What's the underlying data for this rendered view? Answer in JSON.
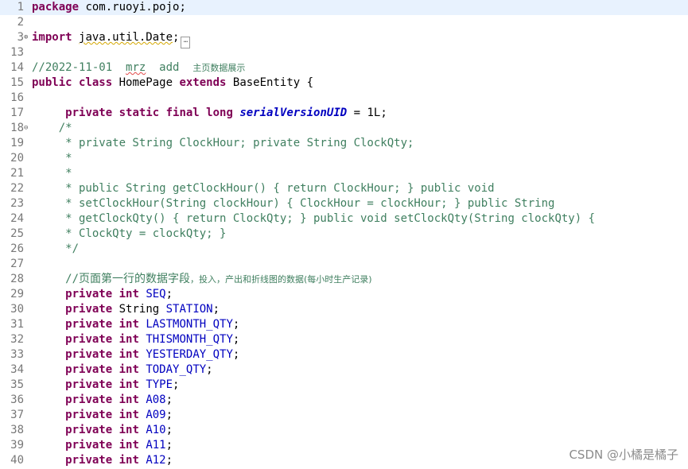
{
  "editor": {
    "lines": [
      {
        "n": "1",
        "segs": [
          {
            "t": "package",
            "c": "kw"
          },
          {
            "t": " com.ruoyi.pojo;"
          }
        ]
      },
      {
        "n": "2",
        "segs": []
      },
      {
        "n": "3",
        "fold": "⊕",
        "segs": [
          {
            "t": "import",
            "c": "kw"
          },
          {
            "t": " "
          },
          {
            "t": "java.util.Date",
            "c": "warn"
          },
          {
            "t": ";"
          },
          {
            "t": "…",
            "c": "collapsed"
          }
        ]
      },
      {
        "n": "13",
        "segs": []
      },
      {
        "n": "14",
        "segs": [
          {
            "t": "//2022-11-01  ",
            "c": "cm"
          },
          {
            "t": "mrz",
            "c": "cm spell"
          },
          {
            "t": "  add  ",
            "c": "cm"
          },
          {
            "t": "主页数据展示",
            "c": "cm cjk"
          }
        ]
      },
      {
        "n": "15",
        "segs": [
          {
            "t": "public class",
            "c": "kw"
          },
          {
            "t": " HomePage "
          },
          {
            "t": "extends",
            "c": "kw"
          },
          {
            "t": " BaseEntity {"
          }
        ]
      },
      {
        "n": "16",
        "segs": []
      },
      {
        "n": "17",
        "segs": [
          {
            "t": "     "
          },
          {
            "t": "private static final long",
            "c": "kw"
          },
          {
            "t": " "
          },
          {
            "t": "serialVersionUID",
            "c": "sf"
          },
          {
            "t": " = 1L;"
          }
        ]
      },
      {
        "n": "18",
        "fold": "⊖",
        "segs": [
          {
            "t": "    /*",
            "c": "cm"
          }
        ]
      },
      {
        "n": "19",
        "segs": [
          {
            "t": "     * private String ClockHour; private String ClockQty;",
            "c": "cm"
          }
        ]
      },
      {
        "n": "20",
        "segs": [
          {
            "t": "     *",
            "c": "cm"
          }
        ]
      },
      {
        "n": "21",
        "segs": [
          {
            "t": "     *",
            "c": "cm"
          }
        ]
      },
      {
        "n": "22",
        "segs": [
          {
            "t": "     * public String getClockHour() { return ClockHour; } public void",
            "c": "cm"
          }
        ]
      },
      {
        "n": "23",
        "segs": [
          {
            "t": "     * setClockHour(String clockHour) { ClockHour = clockHour; } public String",
            "c": "cm"
          }
        ]
      },
      {
        "n": "24",
        "segs": [
          {
            "t": "     * getClockQty() { return ClockQty; } public void setClockQty(String clockQty) {",
            "c": "cm"
          }
        ]
      },
      {
        "n": "25",
        "segs": [
          {
            "t": "     * ClockQty = clockQty; }",
            "c": "cm"
          }
        ]
      },
      {
        "n": "26",
        "segs": [
          {
            "t": "     */",
            "c": "cm"
          }
        ]
      },
      {
        "n": "27",
        "segs": []
      },
      {
        "n": "28",
        "segs": [
          {
            "t": "     //页面第一行的数据字段",
            "c": "cm"
          },
          {
            "t": "，投入，产出和折线图的数据(每小时生产记录)",
            "c": "cm cjk"
          }
        ]
      },
      {
        "n": "29",
        "segs": [
          {
            "t": "     "
          },
          {
            "t": "private int",
            "c": "kw"
          },
          {
            "t": " "
          },
          {
            "t": "SEQ",
            "c": "fd"
          },
          {
            "t": ";"
          }
        ]
      },
      {
        "n": "30",
        "segs": [
          {
            "t": "     "
          },
          {
            "t": "private",
            "c": "kw"
          },
          {
            "t": " String "
          },
          {
            "t": "STATION",
            "c": "fd"
          },
          {
            "t": ";"
          }
        ]
      },
      {
        "n": "31",
        "segs": [
          {
            "t": "     "
          },
          {
            "t": "private int",
            "c": "kw"
          },
          {
            "t": " "
          },
          {
            "t": "LASTMONTH_QTY",
            "c": "fd"
          },
          {
            "t": ";"
          }
        ]
      },
      {
        "n": "32",
        "segs": [
          {
            "t": "     "
          },
          {
            "t": "private int",
            "c": "kw"
          },
          {
            "t": " "
          },
          {
            "t": "THISMONTH_QTY",
            "c": "fd"
          },
          {
            "t": ";"
          }
        ]
      },
      {
        "n": "33",
        "segs": [
          {
            "t": "     "
          },
          {
            "t": "private int",
            "c": "kw"
          },
          {
            "t": " "
          },
          {
            "t": "YESTERDAY_QTY",
            "c": "fd"
          },
          {
            "t": ";"
          }
        ]
      },
      {
        "n": "34",
        "segs": [
          {
            "t": "     "
          },
          {
            "t": "private int",
            "c": "kw"
          },
          {
            "t": " "
          },
          {
            "t": "TODAY_QTY",
            "c": "fd"
          },
          {
            "t": ";"
          }
        ]
      },
      {
        "n": "35",
        "segs": [
          {
            "t": "     "
          },
          {
            "t": "private int",
            "c": "kw"
          },
          {
            "t": " "
          },
          {
            "t": "TYPE",
            "c": "fd"
          },
          {
            "t": ";"
          }
        ]
      },
      {
        "n": "36",
        "segs": [
          {
            "t": "     "
          },
          {
            "t": "private int",
            "c": "kw"
          },
          {
            "t": " "
          },
          {
            "t": "A08",
            "c": "fd"
          },
          {
            "t": ";"
          }
        ]
      },
      {
        "n": "37",
        "segs": [
          {
            "t": "     "
          },
          {
            "t": "private int",
            "c": "kw"
          },
          {
            "t": " "
          },
          {
            "t": "A09",
            "c": "fd"
          },
          {
            "t": ";"
          }
        ]
      },
      {
        "n": "38",
        "segs": [
          {
            "t": "     "
          },
          {
            "t": "private int",
            "c": "kw"
          },
          {
            "t": " "
          },
          {
            "t": "A10",
            "c": "fd"
          },
          {
            "t": ";"
          }
        ]
      },
      {
        "n": "39",
        "segs": [
          {
            "t": "     "
          },
          {
            "t": "private int",
            "c": "kw"
          },
          {
            "t": " "
          },
          {
            "t": "A11",
            "c": "fd"
          },
          {
            "t": ";"
          }
        ]
      },
      {
        "n": "40",
        "segs": [
          {
            "t": "     "
          },
          {
            "t": "private int",
            "c": "kw"
          },
          {
            "t": " "
          },
          {
            "t": "A12",
            "c": "fd"
          },
          {
            "t": ";"
          }
        ]
      }
    ]
  },
  "watermark": "CSDN @小橘是橘子",
  "colors": {
    "keyword": "#7f0055",
    "comment": "#3f7f5f",
    "field": "#0000c0",
    "line_number": "#787878",
    "current_line": "#e8f2fe"
  }
}
